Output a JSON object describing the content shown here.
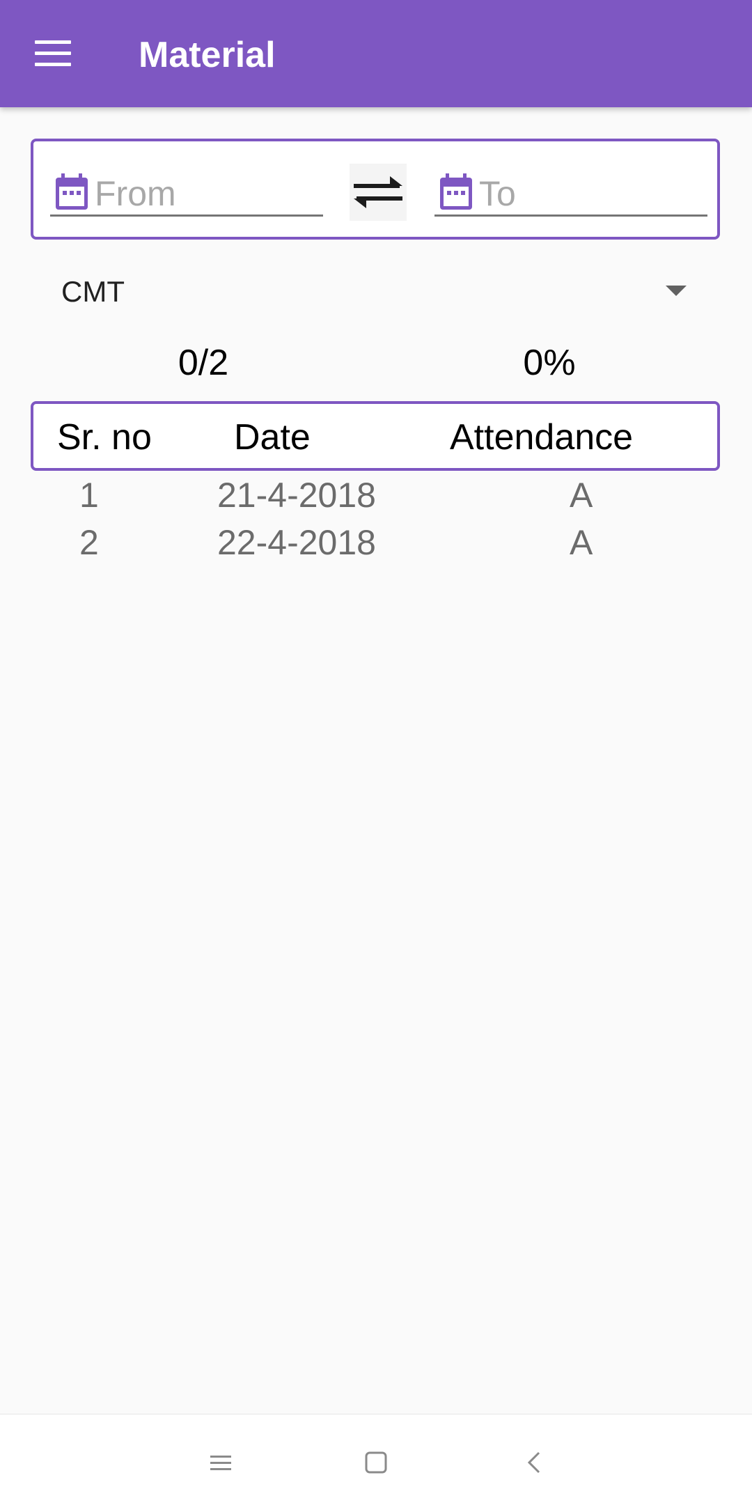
{
  "app_bar": {
    "title": "Material",
    "menu_icon": "hamburger-menu-icon",
    "color": "#7e57c2"
  },
  "date_range": {
    "from_placeholder": "From",
    "to_placeholder": "To",
    "calendar_icon": "calendar-icon",
    "swap_icon": "swap-arrows-icon"
  },
  "subject_select": {
    "selected": "CMT"
  },
  "summary": {
    "count": "0/2",
    "percent": "0%"
  },
  "table": {
    "columns": [
      "Sr. no",
      "Date",
      "Attendance"
    ],
    "rows": [
      [
        "1",
        "21-4-2018",
        "A"
      ],
      [
        "2",
        "22-4-2018",
        "A"
      ]
    ]
  },
  "system_nav": {
    "recent_icon": "recent-apps-icon",
    "home_icon": "home-icon",
    "back_icon": "back-icon"
  }
}
